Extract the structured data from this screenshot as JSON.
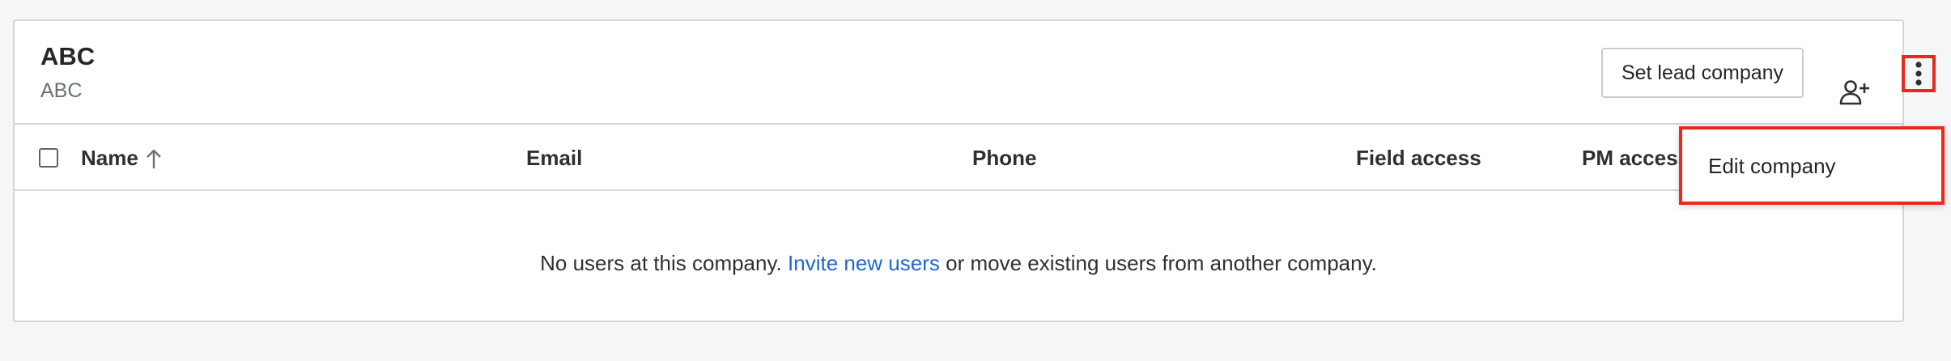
{
  "company": {
    "name": "ABC",
    "subtitle": "ABC"
  },
  "header_actions": {
    "lead_button_label": "Set lead company",
    "add_user_icon": "user-plus-icon",
    "more_icon": "kebab-vertical-icon"
  },
  "table": {
    "columns": [
      "Name",
      "Email",
      "Phone",
      "Field access",
      "PM access"
    ],
    "sort_icon": "arrow-up-icon"
  },
  "empty_state": {
    "before": "No users at this company.",
    "link": "Invite new users",
    "after": "or move existing users from another company."
  },
  "menu": {
    "items": [
      "Edit company"
    ]
  },
  "colors": {
    "highlight": "#e8291c",
    "link": "#2166d3",
    "border": "#d2d6db"
  }
}
